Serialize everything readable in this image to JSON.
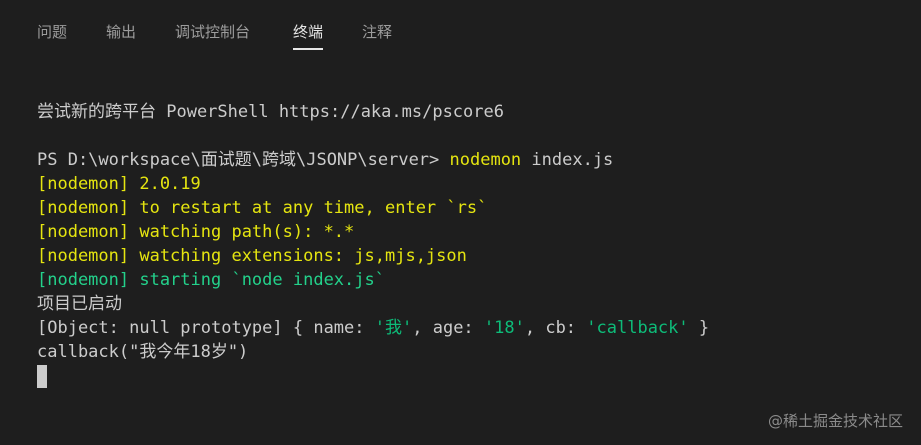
{
  "tabs": [
    {
      "label": "问题"
    },
    {
      "label": "输出"
    },
    {
      "label": "调试控制台"
    },
    {
      "label": "终端",
      "active": true
    },
    {
      "label": "注释"
    }
  ],
  "terminal": {
    "banner": "尝试新的跨平台 PowerShell https://aka.ms/pscore6",
    "prompt": "PS D:\\workspace\\面试题\\跨域\\JSONP\\server> ",
    "command_name": "nodemon",
    "command_args": " index.js",
    "nodemon_version": "[nodemon] 2.0.19",
    "nodemon_restart": "[nodemon] to restart at any time, enter `rs`",
    "nodemon_watch_path": "[nodemon] watching path(s): *.*",
    "nodemon_watch_ext": "[nodemon] watching extensions: js,mjs,json",
    "nodemon_starting": "[nodemon] starting `node index.js`",
    "server_started": "项目已启动",
    "object_line": {
      "prefix": "[Object: null prototype] { name: ",
      "name_val": "'我'",
      "mid1": ", age: ",
      "age_val": "'18'",
      "mid2": ", cb: ",
      "cb_val": "'callback'",
      "suffix": " }"
    },
    "callback_line": "callback(\"我今年18岁\")"
  },
  "watermark": "@稀土掘金技术社区",
  "colors": {
    "background": "#1e1e1e",
    "text": "#cccccc",
    "yellow": "#e5e510",
    "green": "#23d18b",
    "string": "#0dbc79"
  }
}
